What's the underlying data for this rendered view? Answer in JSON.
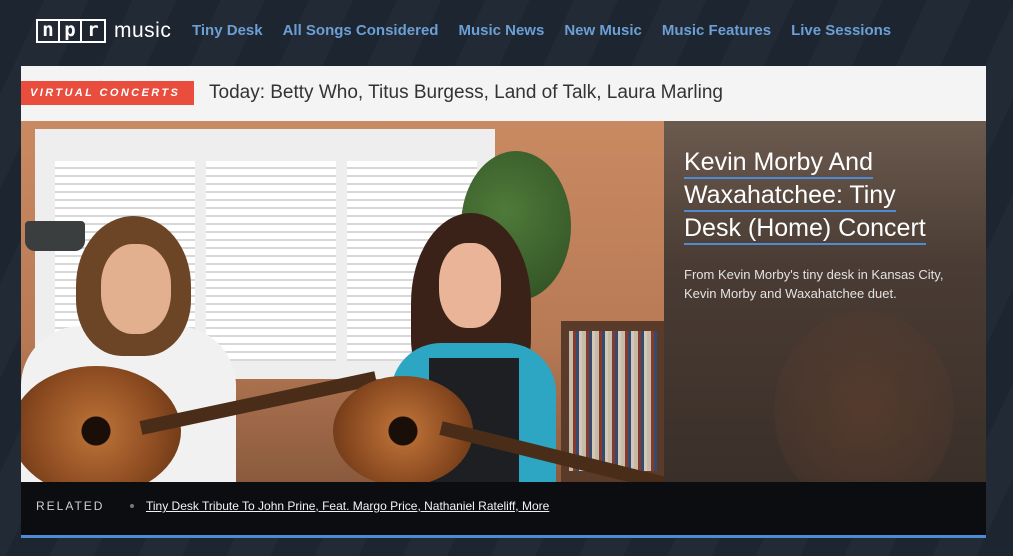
{
  "logo": {
    "letters": [
      "n",
      "p",
      "r"
    ],
    "word": "music"
  },
  "nav": {
    "items": [
      {
        "label": "Tiny Desk"
      },
      {
        "label": "All Songs Considered"
      },
      {
        "label": "Music News"
      },
      {
        "label": "New Music"
      },
      {
        "label": "Music Features"
      },
      {
        "label": "Live Sessions"
      }
    ]
  },
  "feature": {
    "tag": "Virtual Concerts",
    "today": "Today: Betty Who, Titus Burgess, Land of Talk, Laura Marling",
    "title_lines": [
      "Kevin Morby And",
      "Waxahatchee: Tiny",
      "Desk (Home) Concert"
    ],
    "description": "From Kevin Morby's tiny desk in Kansas City, Kevin Morby and Waxahatchee duet."
  },
  "related": {
    "label": "Related",
    "link": "Tiny Desk Tribute To John Prine, Feat. Margo Price, Nathaniel Rateliff, More"
  },
  "colors": {
    "background": "#1d2530",
    "nav_link": "#6b9fd6",
    "tag": "#e94d3d",
    "accent_underline": "#4d8bd4"
  }
}
